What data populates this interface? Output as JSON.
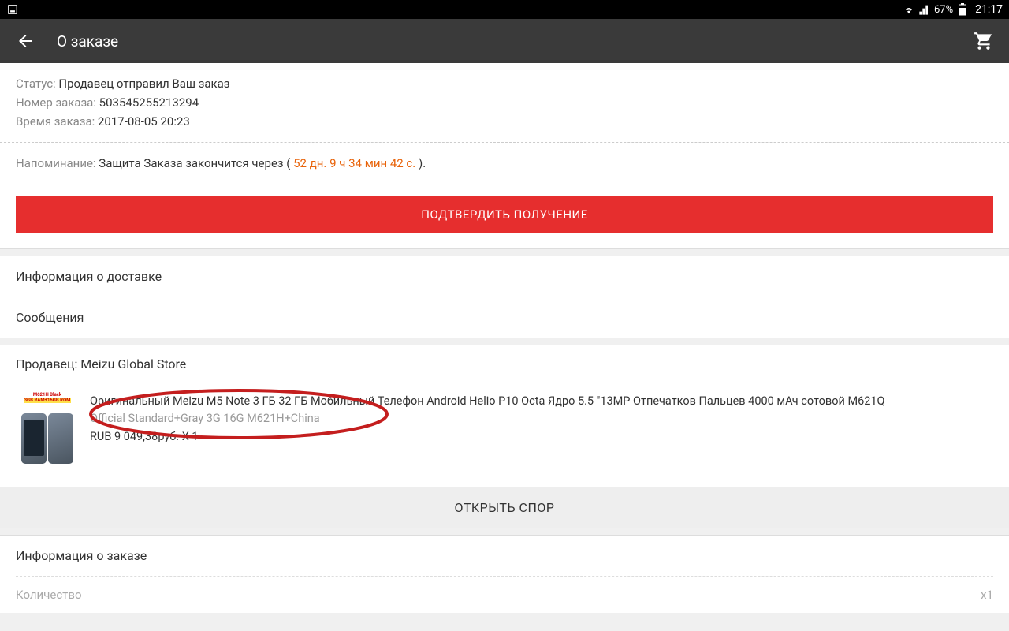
{
  "statusBar": {
    "battery": "67%",
    "time": "21:17"
  },
  "appBar": {
    "title": "О заказе"
  },
  "orderStatus": {
    "statusLabel": "Статус:",
    "statusValue": "Продавец отправил Ваш заказ",
    "orderNumLabel": "Номер заказа:",
    "orderNumValue": "503545255213294",
    "orderTimeLabel": "Время заказа:",
    "orderTimeValue": "2017-08-05 20:23"
  },
  "reminder": {
    "label": "Напоминание:",
    "prefix": "Защита Заказа закончится через (",
    "countdown": "52 дн. 9 ч 34 мин 42 с.",
    "suffix": ")."
  },
  "confirmBtn": "ПОДТВЕРДИТЬ ПОЛУЧЕНИЕ",
  "links": {
    "delivery": "Информация о доставке",
    "messages": "Сообщения"
  },
  "seller": {
    "label": "Продавец:",
    "name": "Meizu Global Store"
  },
  "product": {
    "imgTop1": "M621H Black",
    "imgTop2": "3GB RAM+16GB ROM",
    "title": "Оригинальный Meizu M5 Note 3 ГБ 32 ГБ Мобильный Телефон Android Helio P10 Octa Ядро 5.5 \"13MP Отпечатков Пальцев 4000 мАч сотовой M621Q",
    "variant": "Official Standard+Gray 3G 16G M621H+China",
    "priceCurrency": "RUB",
    "priceValue": "9 049,38руб.",
    "qtySuffix": "X 1"
  },
  "disputeBtn": "ОТКРЫТЬ СПОР",
  "orderInfoSection": "Информация о заказе",
  "quantity": {
    "label": "Количество",
    "value": "x1"
  }
}
